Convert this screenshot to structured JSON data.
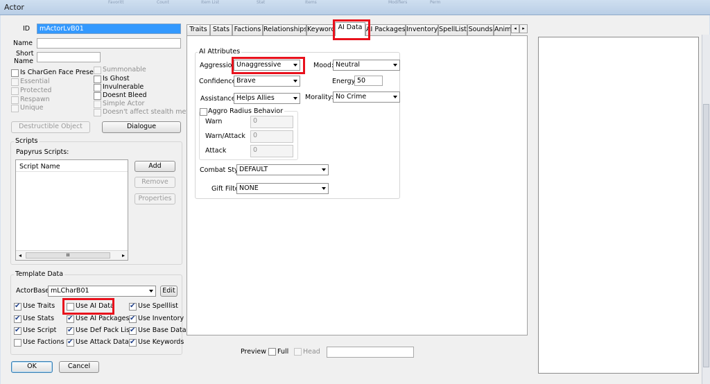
{
  "window": {
    "title": "Actor",
    "ghost_labels": [
      "Favoritt",
      "Count",
      "Item List",
      "Stat",
      "Items",
      "Modifiers",
      "Perm"
    ]
  },
  "basic": {
    "id_label": "ID",
    "id_value": "mActorLvB01",
    "name_label": "Name",
    "name_value": "",
    "short_name_label_1": "Short",
    "short_name_label_2": "Name",
    "short_name_value": ""
  },
  "flags_left": [
    {
      "label": "Is CharGen Face Preset",
      "checked": false,
      "disabled": false
    },
    {
      "label": "Essential",
      "checked": false,
      "disabled": true
    },
    {
      "label": "Protected",
      "checked": false,
      "disabled": true
    },
    {
      "label": "Respawn",
      "checked": false,
      "disabled": true
    },
    {
      "label": "Unique",
      "checked": false,
      "disabled": true
    }
  ],
  "flags_right": [
    {
      "label": "Summonable",
      "checked": false,
      "disabled": true
    },
    {
      "label": "Is Ghost",
      "checked": false,
      "disabled": false
    },
    {
      "label": "Invulnerable",
      "checked": false,
      "disabled": false
    },
    {
      "label": "Doesnt Bleed",
      "checked": false,
      "disabled": false
    },
    {
      "label": "Simple Actor",
      "checked": false,
      "disabled": true
    },
    {
      "label": "Doesn't affect stealth meter",
      "checked": false,
      "disabled": true
    }
  ],
  "buttons": {
    "destructible": "Destructible Object",
    "dialogue": "Dialogue",
    "ok": "OK",
    "cancel": "Cancel"
  },
  "scripts": {
    "group_title": "Scripts",
    "papyrus_label": "Papyrus Scripts:",
    "column_header": "Script Name",
    "add": "Add",
    "remove": "Remove",
    "properties": "Properties",
    "hscroll_left": "◂",
    "hscroll_thumb": "III",
    "hscroll_right": "▸"
  },
  "template": {
    "group_title": "Template Data",
    "actorbase_label": "ActorBase",
    "actorbase_value": "mLCharB01",
    "edit": "Edit",
    "checks": [
      {
        "label": "Use Traits",
        "checked": true
      },
      {
        "label": "Use AI Data",
        "checked": false
      },
      {
        "label": "Use Spelllist",
        "checked": true
      },
      {
        "label": "Use Stats",
        "checked": true
      },
      {
        "label": "Use AI Packages",
        "checked": true
      },
      {
        "label": "Use Inventory",
        "checked": true
      },
      {
        "label": "Use Script",
        "checked": true
      },
      {
        "label": "Use Def Pack List",
        "checked": true
      },
      {
        "label": "Use Base Data",
        "checked": true
      },
      {
        "label": "Use Factions",
        "checked": false
      },
      {
        "label": "Use Attack Data",
        "checked": true
      },
      {
        "label": "Use Keywords",
        "checked": true
      }
    ]
  },
  "tabs": [
    {
      "label": "Traits"
    },
    {
      "label": "Stats"
    },
    {
      "label": "Factions"
    },
    {
      "label": "Relationships"
    },
    {
      "label": "Keyword"
    },
    {
      "label": "AI Data",
      "active": true
    },
    {
      "label": "AI Packages"
    },
    {
      "label": "Inventory"
    },
    {
      "label": "SpellList"
    },
    {
      "label": "Sounds"
    },
    {
      "label": "Anim"
    }
  ],
  "tab_scroll": {
    "left": "◂",
    "right": "▸"
  },
  "ai": {
    "group_title": "AI Attributes",
    "aggression_label": "Aggression:",
    "aggression_value": "Unaggressive",
    "mood_label": "Mood:",
    "mood_value": "Neutral",
    "confidence_label": "Confidence:",
    "confidence_value": "Brave",
    "energy_label": "Energy:",
    "energy_value": "50",
    "assistance_label": "Assistance:",
    "assistance_value": "Helps Allies",
    "morality_label": "Morality:",
    "morality_value": "No Crime",
    "aggro_label": "Aggro Radius Behavior",
    "aggro_checked": false,
    "warn_label": "Warn",
    "warn_value": "0",
    "warn_attack_label": "Warn/Attack",
    "warn_attack_value": "0",
    "attack_label": "Attack",
    "attack_value": "0",
    "combat_style_label": "Combat Style",
    "combat_style_value": "DEFAULT",
    "gift_filter_label": "Gift Filter",
    "gift_filter_value": "NONE"
  },
  "preview": {
    "label": "Preview",
    "full": "Full",
    "head": "Head",
    "full_checked": false,
    "head_disabled": true
  },
  "colors": {
    "highlight": "#e8111c",
    "selection": "#3399ff"
  }
}
